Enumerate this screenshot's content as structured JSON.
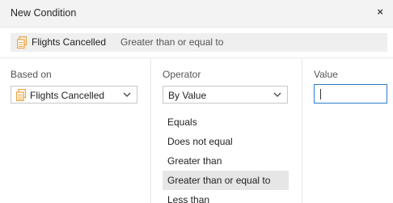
{
  "dialog": {
    "title": "New Condition",
    "close_glyph": "×"
  },
  "summary": {
    "field": "Flights Cancelled",
    "operator": "Greater than or equal to",
    "icon": "field-table-icon",
    "icon_color": "#e8a33a"
  },
  "based_on": {
    "label": "Based on",
    "value": "Flights Cancelled",
    "icon": "field-table-icon"
  },
  "operator": {
    "label": "Operator",
    "value": "By Value",
    "options": [
      "Equals",
      "Does not equal",
      "Greater than",
      "Greater than or equal to",
      "Less than"
    ],
    "selected": "Greater than or equal to"
  },
  "value": {
    "label": "Value",
    "current": ""
  },
  "colors": {
    "focus_border": "#2e7bd0",
    "selected_item_bg": "#e6e6e6"
  }
}
